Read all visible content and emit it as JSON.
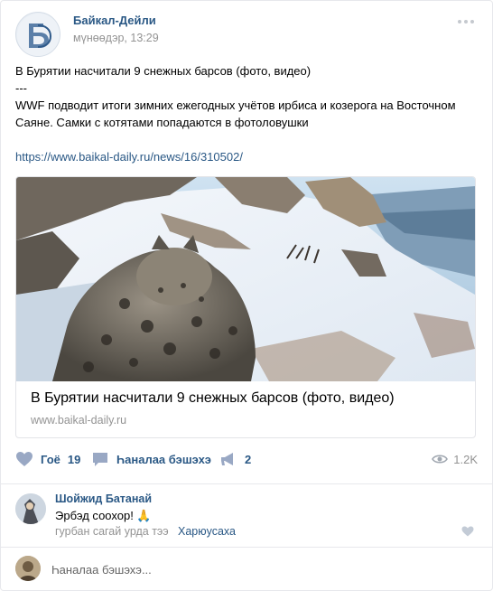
{
  "post": {
    "author": "Байкал-Дейли",
    "date": "мүнөөдэр, 13:29",
    "text_lines": [
      "В Бурятии насчитали 9 снежных барсов (фото, видео)",
      "---",
      "WWF подводит итоги зимних ежегодных учётов ирбиса и козерога на Восточном",
      "Саяне. Самки с котятами попадаются в фотоловушки"
    ],
    "link": "https://www.baikal-daily.ru/news/16/310502/"
  },
  "attachment": {
    "title": "В Бурятии насчитали 9 снежных барсов (фото, видео)",
    "domain": "www.baikal-daily.ru"
  },
  "actions": {
    "like_label": "Гоё",
    "like_count": "19",
    "comment_label": "Һаналаа бэшэхэ",
    "share_count": "2",
    "views": "1.2K"
  },
  "comment": {
    "author": "Шойжид Батанай",
    "text": "Эрбэд соохор! 🙏",
    "time": "гурбан сагай урда тээ",
    "reply_label": "Харюусаха"
  },
  "reply_box": {
    "placeholder": "Һаналаа бэшэхэ..."
  },
  "colors": {
    "link": "#2a5885",
    "muted": "#939393",
    "icon": "#7a8ba6"
  }
}
